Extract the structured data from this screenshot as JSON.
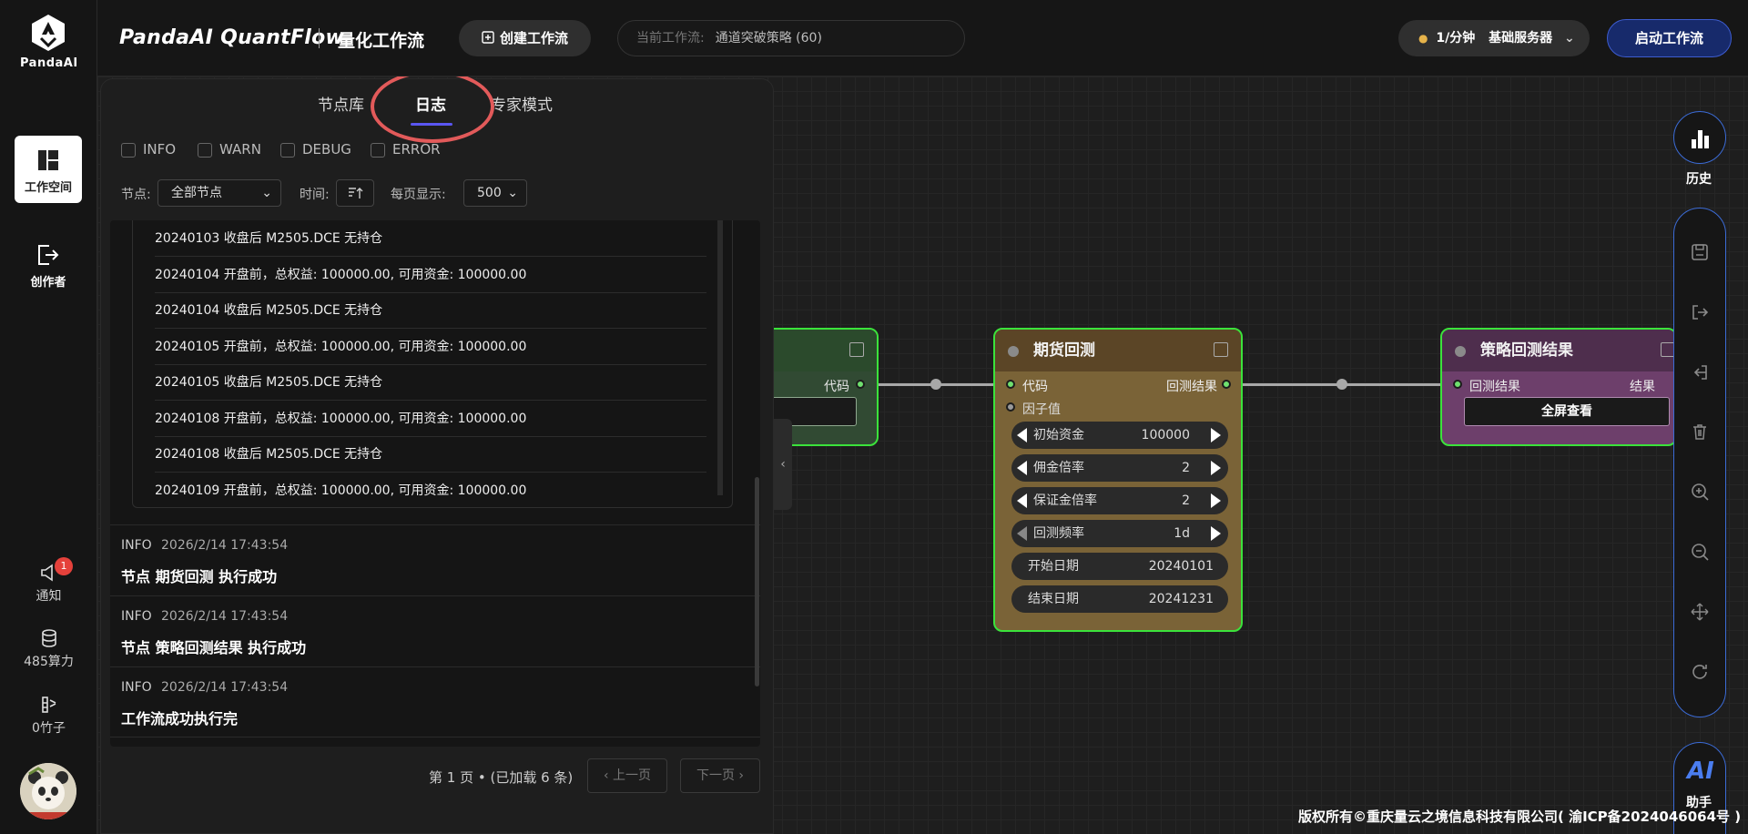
{
  "brand": {
    "logo_text": "PandaAI",
    "title": "PandaAI QuantFlow",
    "subtitle": "量化工作流"
  },
  "sidebar": {
    "items": [
      {
        "label": "工作空间",
        "icon": "workspace-icon"
      },
      {
        "label": "创作者",
        "icon": "creator-icon"
      }
    ],
    "notify": {
      "label": "通知",
      "badge": "1"
    },
    "compute": {
      "label": "485算力"
    },
    "bamboo": {
      "label": "0竹子"
    }
  },
  "header": {
    "create_label": "创建工作流",
    "current_label": "当前工作流:",
    "current_value": "通道突破策略 (60)",
    "server_rate": "1/分钟",
    "server_name": "基础服务器",
    "start_label": "启动工作流"
  },
  "panel": {
    "tabs": [
      "节点库",
      "日志",
      "专家模式"
    ],
    "filters": [
      "INFO",
      "WARN",
      "DEBUG",
      "ERROR"
    ],
    "node_label": "节点:",
    "node_select": "全部节点",
    "time_label": "时间:",
    "page_size_label": "每页显示:",
    "page_size": "500",
    "sub_lines": [
      "20240103 收盘后 M2505.DCE 无持仓",
      "20240104 开盘前，总权益: 100000.00, 可用资金: 100000.00",
      "20240104 收盘后 M2505.DCE 无持仓",
      "20240105 开盘前，总权益: 100000.00, 可用资金: 100000.00",
      "20240105 收盘后 M2505.DCE 无持仓",
      "20240108 开盘前，总权益: 100000.00, 可用资金: 100000.00",
      "20240108 收盘后 M2505.DCE 无持仓",
      "20240109 开盘前，总权益: 100000.00, 可用资金: 100000.00"
    ],
    "entries": [
      {
        "level": "INFO",
        "time": "2026/2/14 17:43:54",
        "message": "节点 期货回测 执行成功"
      },
      {
        "level": "INFO",
        "time": "2026/2/14 17:43:54",
        "message": "节点 策略回测结果 执行成功"
      },
      {
        "level": "INFO",
        "time": "2026/2/14 17:43:54",
        "message": "工作流成功执行完"
      }
    ],
    "pager": {
      "info": "第 1 页 • (已加载 6 条)",
      "prev": "上一页",
      "next": "下一页"
    }
  },
  "nodes": {
    "left": {
      "out_port": "代码"
    },
    "futures": {
      "title": "期货回测",
      "in1": "代码",
      "in2": "因子值",
      "out": "回测结果",
      "params": [
        {
          "label": "初始资金",
          "value": "100000"
        },
        {
          "label": "佣金倍率",
          "value": "2"
        },
        {
          "label": "保证金倍率",
          "value": "2"
        },
        {
          "label": "回测频率",
          "value": "1d"
        },
        {
          "label": "开始日期",
          "value": "20240101"
        },
        {
          "label": "结束日期",
          "value": "20241231"
        }
      ]
    },
    "result": {
      "title": "策略回测结果",
      "in": "回测结果",
      "out": "结果",
      "button": "全屏查看"
    }
  },
  "toolbar": {
    "history": "历史",
    "ai_logo": "AI",
    "ai_label": "助手"
  },
  "footer": "版权所有©重庆量云之境信息科技有限公司( 渝ICP备2024046064号 )"
}
